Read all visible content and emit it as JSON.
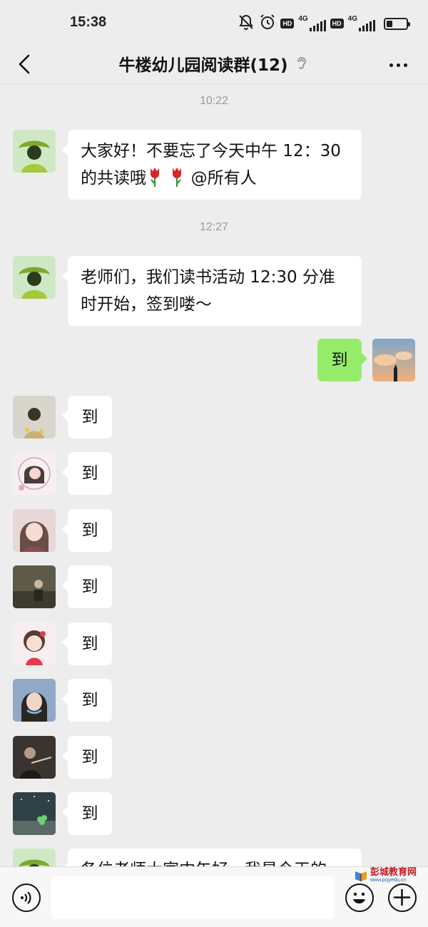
{
  "status_bar": {
    "time": "15:38",
    "hd_label": "HD",
    "network_label": "4G",
    "icons": [
      "mute-bell-icon",
      "alarm-icon",
      "signal-icon",
      "battery-icon"
    ],
    "battery_level": 0.3
  },
  "header": {
    "title": "牛楼幼儿园阅读群(12)",
    "back_icon": "chevron-left-icon",
    "ear_icon": "ear-icon",
    "more_icon": "more-dots-icon"
  },
  "messages": [
    {
      "type": "timestamp",
      "text": "10:22"
    },
    {
      "type": "incoming",
      "avatar": "avatar-green-hat",
      "text_before": "大家好！不要忘了今天中午 12：30 的共读哦",
      "emoji": [
        "tulip",
        "tulip"
      ],
      "text_after": "@所有人"
    },
    {
      "type": "timestamp",
      "text": "12:27"
    },
    {
      "type": "incoming",
      "avatar": "avatar-green-hat",
      "text": "老师们，我们读书活动 12:30 分准时开始，签到喽～"
    },
    {
      "type": "outgoing",
      "avatar": "avatar-sunset",
      "text": "到"
    },
    {
      "type": "incoming",
      "avatar": "avatar-child-flowers",
      "text": "到"
    },
    {
      "type": "incoming",
      "avatar": "avatar-anime-girl-pink",
      "text": "到"
    },
    {
      "type": "incoming",
      "avatar": "avatar-cartoon-girl",
      "text": "到"
    },
    {
      "type": "incoming",
      "avatar": "avatar-dark-outdoor",
      "text": "到"
    },
    {
      "type": "incoming",
      "avatar": "avatar-doll-girl",
      "text": "到"
    },
    {
      "type": "incoming",
      "avatar": "avatar-selfie-girl",
      "text": "到"
    },
    {
      "type": "incoming",
      "avatar": "avatar-violin",
      "text": "到"
    },
    {
      "type": "incoming",
      "avatar": "avatar-clover-night",
      "text": "到"
    },
    {
      "type": "incoming",
      "avatar": "avatar-green-hat",
      "text": "各位老师大家中午好，我是今天的"
    }
  ],
  "input_bar": {
    "voice_icon": "voice-icon",
    "input_value": "",
    "emoji_icon": "emoji-icon",
    "plus_icon": "plus-icon"
  },
  "watermark": {
    "name": "彭城教育网",
    "url": "www.pcjyedu.cn"
  },
  "colors": {
    "background": "#ededed",
    "bubble_incoming": "#ffffff",
    "bubble_outgoing": "#95ec69",
    "timestamp": "#9a9a9a"
  }
}
